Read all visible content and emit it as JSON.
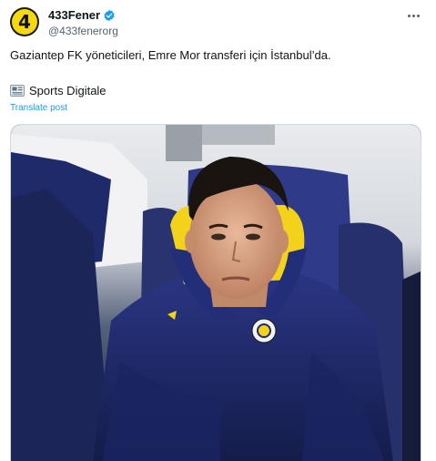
{
  "author": {
    "display_name": "433Fener",
    "handle": "@433fenerorg",
    "avatar_text": "4",
    "avatar_color": "#f5d90a",
    "verified": true
  },
  "tweet": {
    "text": "Gaziantep FK yöneticileri, Emre Mor transferi için İstanbul’da.",
    "source_icon": "newspaper-icon",
    "source": "Sports Digitale",
    "translate_label": "Translate post"
  },
  "media": {
    "type": "photo"
  },
  "colors": {
    "link": "#1d9bf0",
    "verified": "#1d9bf0",
    "secondary_text": "#536471",
    "jacket_navy": "#1f2a6b",
    "hood_yellow": "#f2d21a"
  }
}
